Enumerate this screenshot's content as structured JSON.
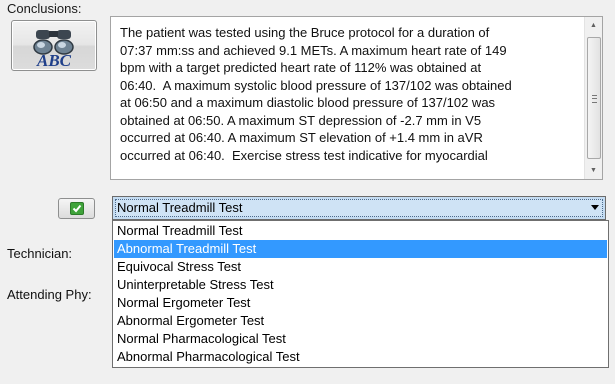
{
  "conclusions": {
    "label": "Conclusions:",
    "abc_button_text": "ABC",
    "text": "The patient was tested using the Bruce protocol for a duration of\n07:37 mm:ss and achieved 9.1 METs. A maximum heart rate of 149\nbpm with a target predicted heart rate of 112% was obtained at\n06:40.  A maximum systolic blood pressure of 137/102 was obtained\nat 06:50 and a maximum diastolic blood pressure of 137/102 was\nobtained at 06:50. A maximum ST depression of -2.7 mm in V5\noccurred at 06:40. A maximum ST elevation of +1.4 mm in aVR\noccurred at 06:40.  Exercise stress test indicative for myocardial"
  },
  "icons": {
    "abc": "binoculars-abc-icon",
    "accept": "green-check-icon",
    "combo_arrow": "chevron-down-icon",
    "scroll_up": "scroll-up-arrow-icon",
    "scroll_down": "scroll-down-arrow-icon"
  },
  "colors": {
    "selection": "#3399ff",
    "combo_highlight": "#c4dcf2",
    "accept_green": "#3fa33a"
  },
  "combo": {
    "selected_value": "Normal Treadmill Test"
  },
  "dropdown": {
    "options": [
      "Normal Treadmill Test",
      "Abnormal Treadmill Test",
      "Equivocal Stress Test",
      "Uninterpretable Stress Test",
      "Normal Ergometer Test",
      "Abnormal Ergometer Test",
      "Normal Pharmacological Test",
      "Abnormal Pharmacological Test"
    ],
    "highlighted_index": 1
  },
  "labels": {
    "technician": "Technician:",
    "attending": "Attending Phy:"
  }
}
